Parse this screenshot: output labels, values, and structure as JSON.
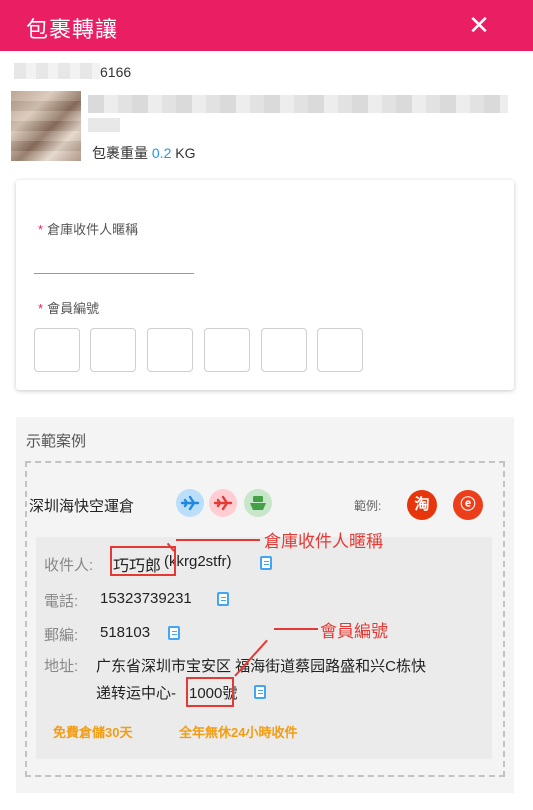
{
  "header": {
    "title": "包裹轉讓",
    "close_icon": "✕"
  },
  "package": {
    "id_suffix": "6166",
    "weight_label": "包裹重量",
    "weight_value": "0.2",
    "weight_unit": "KG"
  },
  "form": {
    "nickname_label": "倉庫收件人暱稱",
    "nickname_value": "",
    "member_label": "會員編號",
    "member_digits": [
      "",
      "",
      "",
      "",
      "",
      ""
    ],
    "required_mark": "*"
  },
  "example": {
    "title": "示範案例",
    "warehouse_name": "深圳海快空運倉",
    "mode_icons": [
      "airplane-icon",
      "airplane-icon",
      "ship-icon"
    ],
    "example_label": "範例:",
    "shops": [
      {
        "name": "taobao-icon",
        "glyph": "淘",
        "color": "#e8360c"
      },
      {
        "name": "alibaba-icon",
        "glyph": "ⓔ",
        "color": "#ec3e1a"
      }
    ],
    "rows": {
      "recipient_label": "收件人:",
      "recipient_name": "巧巧郎",
      "recipient_code": "(kkrg2stfr)",
      "phone_label": "電話:",
      "phone_value": "15323739231",
      "zip_label": "郵編:",
      "zip_value": "518103",
      "address_label": "地址:",
      "address_line1": "广东省深圳市宝安区 福海街道蔡园路盛和兴C栋快",
      "address_line2": "递转运中心-",
      "address_code": "1000號"
    },
    "callouts": {
      "nickname": "倉庫收件人暱稱",
      "member": "會員編號"
    },
    "features": [
      "免費倉儲30天",
      "全年無休24小時收件"
    ]
  }
}
